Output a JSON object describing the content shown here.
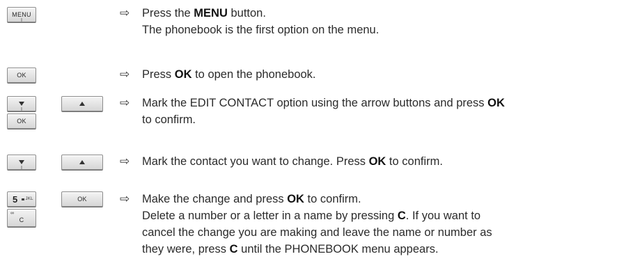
{
  "keys": {
    "menu": "MENU",
    "ok": "OK",
    "five_digit": "5",
    "five_letters": "JKL",
    "c_label": "C",
    "voicemail_symbol": "∞"
  },
  "pointer_symbol": "⇨",
  "steps": [
    {
      "l1_before": "Press the ",
      "l1_bold": "MENU",
      "l1_after": " button.",
      "l2": "The phonebook is the first option on the menu."
    },
    {
      "before": "Press ",
      "bold": "OK",
      "after": " to open the phonebook."
    },
    {
      "l1_before": "Mark the EDIT CONTACT option using the arrow buttons and press ",
      "l1_bold": "OK",
      "l2": "to confirm."
    },
    {
      "before": "Mark the contact you want to change. Press ",
      "bold": "OK",
      "after": " to confirm."
    },
    {
      "l1_before": "Make the change and press ",
      "l1_bold": "OK",
      "l1_after": " to confirm.",
      "l2_before": "Delete a number or a letter in a name by pressing ",
      "l2_bold": "C",
      "l2_after": ". If you want to",
      "l3": "cancel the change you are making and leave the name or number as",
      "l4_before": "they were, press ",
      "l4_bold": "C",
      "l4_after": " until the PHONEBOOK menu appears."
    }
  ]
}
